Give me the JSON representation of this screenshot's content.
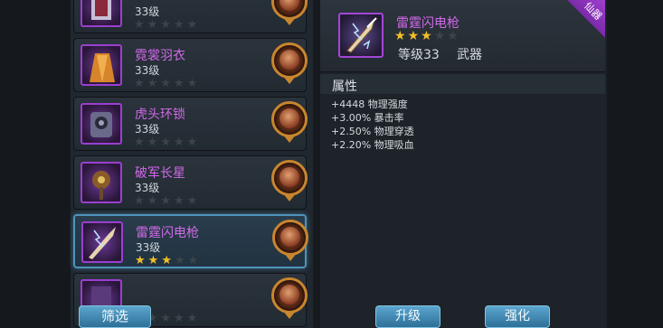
{
  "equipment_list": [
    {
      "name": "",
      "level": "33级",
      "stars_on": 0,
      "stars_total": 5,
      "selected": false,
      "icon": "armor-icon"
    },
    {
      "name": "霓裳羽衣",
      "level": "33级",
      "stars_on": 0,
      "stars_total": 5,
      "selected": false,
      "icon": "robe-icon"
    },
    {
      "name": "虎头环锁",
      "level": "33级",
      "stars_on": 0,
      "stars_total": 5,
      "selected": false,
      "icon": "chain-armor-icon"
    },
    {
      "name": "破军长星",
      "level": "33级",
      "stars_on": 0,
      "stars_total": 5,
      "selected": false,
      "icon": "mace-icon"
    },
    {
      "name": "雷霆闪电枪",
      "level": "33级",
      "stars_on": 3,
      "stars_total": 5,
      "selected": true,
      "icon": "spear-icon"
    },
    {
      "name": "",
      "level": "",
      "stars_on": 0,
      "stars_total": 5,
      "selected": false,
      "icon": "gauntlet-icon"
    }
  ],
  "filter_label": "筛选",
  "detail": {
    "name": "雷霆闪电枪",
    "stars_on": 3,
    "stars_total": 5,
    "level": "等级33",
    "type": "武器",
    "corner_badge": "仙器",
    "attr_title": "属性",
    "attributes": [
      "+4448 物理强度",
      "+3.00% 暴击率",
      "+2.50% 物理穿透",
      "+2.20% 物理吸血"
    ]
  },
  "upgrade_label": "升级",
  "enhance_label": "强化",
  "colors": {
    "item_name": "#d06ae8",
    "star_on": "#f2c026",
    "star_off": "#3c444b",
    "selection_border": "#4f93bb",
    "button": "#3f8ab6"
  }
}
